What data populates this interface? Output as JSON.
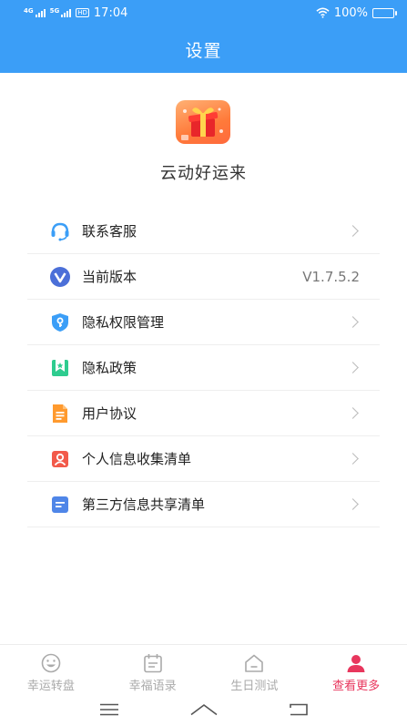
{
  "status_bar": {
    "network1": "4G",
    "network2": "5G",
    "hd": "HD",
    "time": "17:04",
    "battery": "100%"
  },
  "header": {
    "title": "设置"
  },
  "app": {
    "name": "云动好运来"
  },
  "menu": {
    "items": [
      {
        "label": "联系客服",
        "icon": "headset-icon"
      },
      {
        "label": "当前版本",
        "value": "V1.7.5.2",
        "icon": "version-icon"
      },
      {
        "label": "隐私权限管理",
        "icon": "shield-key-icon"
      },
      {
        "label": "隐私政策",
        "icon": "bookmark-star-icon"
      },
      {
        "label": "用户协议",
        "icon": "document-icon"
      },
      {
        "label": "个人信息收集清单",
        "icon": "person-card-icon"
      },
      {
        "label": "第三方信息共享清单",
        "icon": "list-card-icon"
      }
    ]
  },
  "tabs": [
    {
      "label": "幸运转盘",
      "icon": "smiley-icon",
      "active": false
    },
    {
      "label": "幸福语录",
      "icon": "calendar-icon",
      "active": false
    },
    {
      "label": "生日测试",
      "icon": "house-icon",
      "active": false
    },
    {
      "label": "查看更多",
      "icon": "user-icon",
      "active": true
    }
  ],
  "colors": {
    "primary": "#3b9ef7",
    "active_tab": "#e8365d",
    "inactive_tab": "#aaaaaa"
  }
}
